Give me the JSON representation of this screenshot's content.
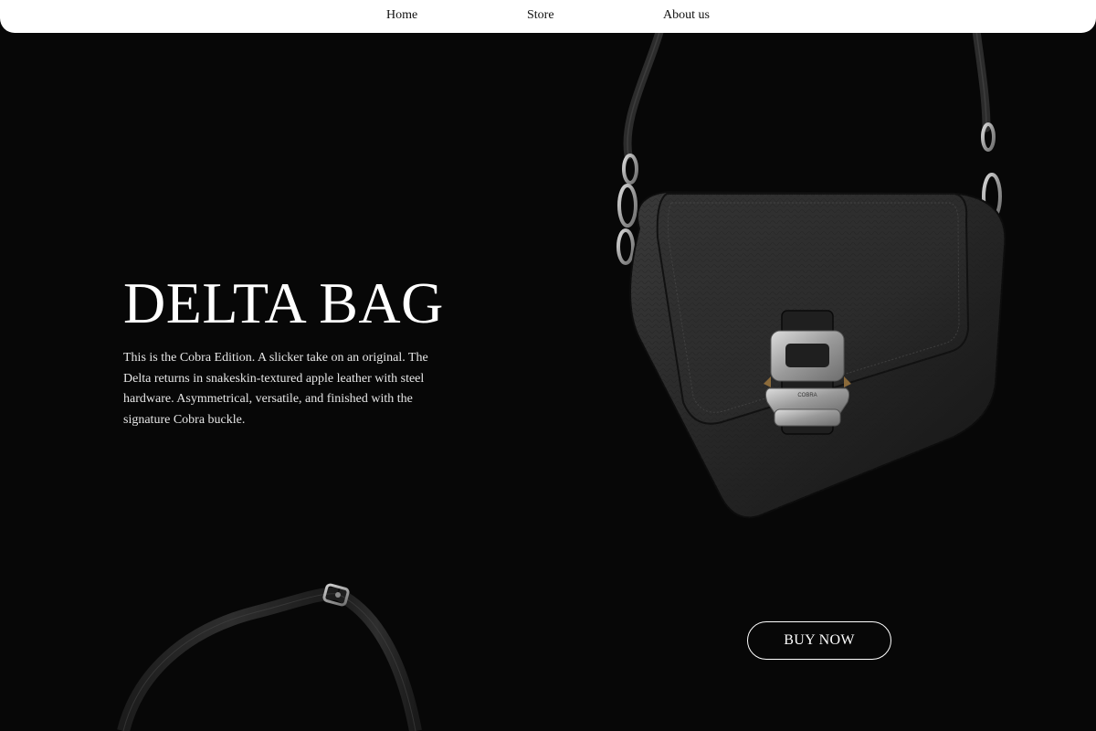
{
  "nav": {
    "items": [
      {
        "label": "Home"
      },
      {
        "label": "Store"
      },
      {
        "label": "About us"
      }
    ]
  },
  "hero": {
    "title": "DELTA BAG",
    "description": "This is the Cobra Edition. A slicker take on an original. The Delta returns in snakeskin-textured apple leather with steel hardware. Asymmetrical, versatile, and finished with the signature Cobra buckle."
  },
  "cta": {
    "label": "BUY NOW"
  },
  "product": {
    "buckle_text": "COBRA"
  },
  "colors": {
    "background": "#070707",
    "nav_background": "#ffffff",
    "text_primary": "#ffffff",
    "leather": "#2a2a2a",
    "hardware": "#b8b8b8"
  },
  "icons": {
    "bag_image": "crossbody-bag-image",
    "strap_image": "bag-strap-image"
  }
}
